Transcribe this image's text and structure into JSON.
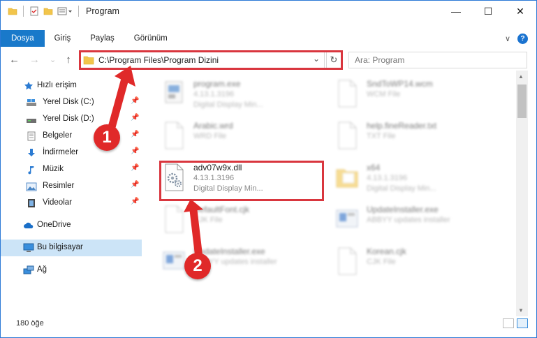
{
  "window": {
    "title": "Program",
    "controls": {
      "minimize": "—",
      "maximize": "☐",
      "close": "✕"
    }
  },
  "ribbon": {
    "tabs": [
      "Dosya",
      "Giriş",
      "Paylaş",
      "Görünüm"
    ],
    "expand": "∨",
    "help": "?"
  },
  "nav": {
    "back": "←",
    "forward": "→",
    "recent": "⌄",
    "up": "↑",
    "address": "C:\\Program Files\\Program Dizini",
    "address_dropdown": "⌄",
    "refresh": "↻",
    "search_placeholder": "Ara: Program"
  },
  "sidebar": {
    "quick_access": "Hızlı erişim",
    "items": [
      {
        "label": "Yerel Disk (C:)",
        "icon": "drive-icon"
      },
      {
        "label": "Yerel Disk (D:)",
        "icon": "drive-icon"
      },
      {
        "label": "Belgeler",
        "icon": "documents-icon"
      },
      {
        "label": "İndirmeler",
        "icon": "downloads-icon"
      },
      {
        "label": "Müzik",
        "icon": "music-icon"
      },
      {
        "label": "Resimler",
        "icon": "pictures-icon"
      },
      {
        "label": "Videolar",
        "icon": "videos-icon"
      }
    ],
    "onedrive": "OneDrive",
    "this_pc": "Bu bilgisayar",
    "network": "Ağ"
  },
  "files": [
    {
      "name": "program.exe",
      "line2": "4.13.1.3196",
      "line3": "Digital Display Min...",
      "col": 0,
      "row": 0,
      "blurred": true,
      "icon": "exe-icon"
    },
    {
      "name": "SndToWP14.wcm",
      "line2": "WCM File",
      "line3": "",
      "col": 1,
      "row": 0,
      "blurred": true,
      "icon": "file-icon"
    },
    {
      "name": "Arabic.wrd",
      "line2": "WRD File",
      "line3": "",
      "col": 0,
      "row": 1,
      "blurred": true,
      "icon": "file-icon"
    },
    {
      "name": "help.fineReader.txt",
      "line2": "TXT File",
      "line3": "",
      "col": 1,
      "row": 1,
      "blurred": true,
      "icon": "file-icon"
    },
    {
      "name": "adv07w9x.dll",
      "line2": "4.13.1.3196",
      "line3": "Digital Display Min...",
      "col": 0,
      "row": 2,
      "blurred": false,
      "icon": "dll-gear-icon"
    },
    {
      "name": "x64",
      "line2": "4.13.1.3196",
      "line3": "Digital Display Min...",
      "col": 1,
      "row": 2,
      "blurred": true,
      "icon": "folder-icon"
    },
    {
      "name": "DefaultFont.cjk",
      "line2": "CJK File",
      "line3": "",
      "col": 0,
      "row": 3,
      "blurred": true,
      "icon": "file-icon"
    },
    {
      "name": "UpdateInstaller.exe",
      "line2": "ABBYY updates installer",
      "line3": "",
      "col": 1,
      "row": 3,
      "blurred": true,
      "icon": "installer-icon"
    },
    {
      "name": "UpdateInstaller.exe",
      "line2": "ABBYY updates installer",
      "line3": "",
      "col": 0,
      "row": 4,
      "blurred": true,
      "icon": "installer-icon"
    },
    {
      "name": "Korean.cjk",
      "line2": "CJK File",
      "line3": "",
      "col": 1,
      "row": 4,
      "blurred": true,
      "icon": "file-icon"
    }
  ],
  "status": {
    "count": "180 öğe"
  },
  "annotations": [
    {
      "label": "1"
    },
    {
      "label": "2"
    }
  ],
  "colors": {
    "accent": "#1979ca",
    "highlight": "#d9363e",
    "selected": "#cce4f7"
  }
}
